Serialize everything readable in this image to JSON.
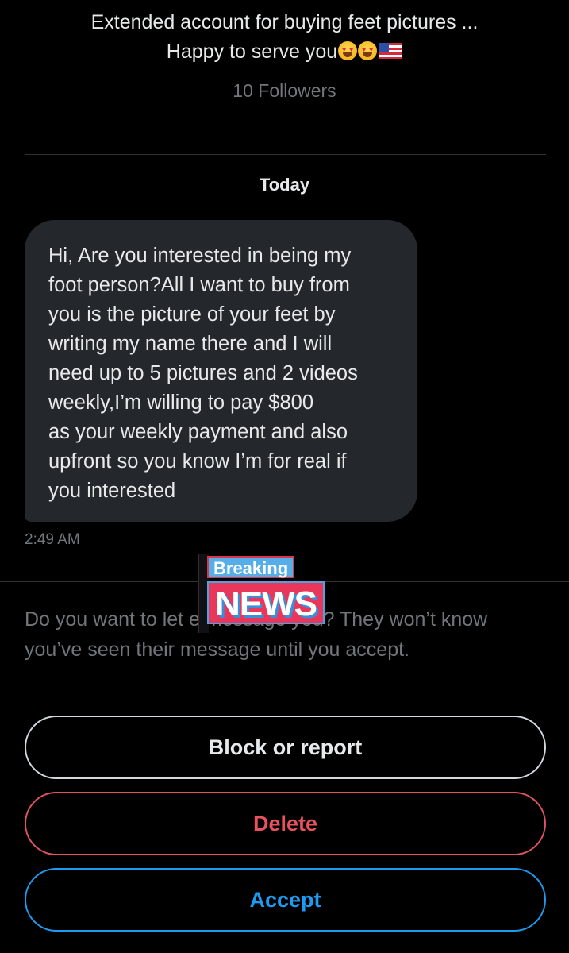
{
  "profile": {
    "bio_line1": "Extended account for buying feet pictures ...",
    "bio_line2_text": "Happy to serve you",
    "bio_emojis": [
      "smiling-face-with-heart-eyes-icon",
      "smiling-face-with-heart-eyes-icon",
      "us-flag-icon"
    ],
    "followers": "10 Followers"
  },
  "conversation": {
    "date_label": "Today",
    "message": {
      "text": "Hi, Are you interested in being my\nfoot person?All I want to buy from\nyou is the picture of your feet by\nwriting my name there  and I will\nneed up to 5 pictures and 2 videos\nweekly,I’m willing to pay $800\nas your weekly payment and also\nupfront so you know I’m for real if\nyou interested",
      "timestamp": "2:49 AM"
    }
  },
  "request_prompt": {
    "text": "Do you want to let                                 e message you? They won’t know you’ve seen their message until you accept."
  },
  "watermark": {
    "top": "Breaking",
    "bottom": "NEWS"
  },
  "actions": {
    "block_label": "Block or report",
    "delete_label": "Delete",
    "accept_label": "Accept"
  },
  "colors": {
    "background": "#000000",
    "bubble": "#24282d",
    "muted_text": "#71767b",
    "delete": "#f4212e",
    "accept": "#1d9bf0"
  }
}
